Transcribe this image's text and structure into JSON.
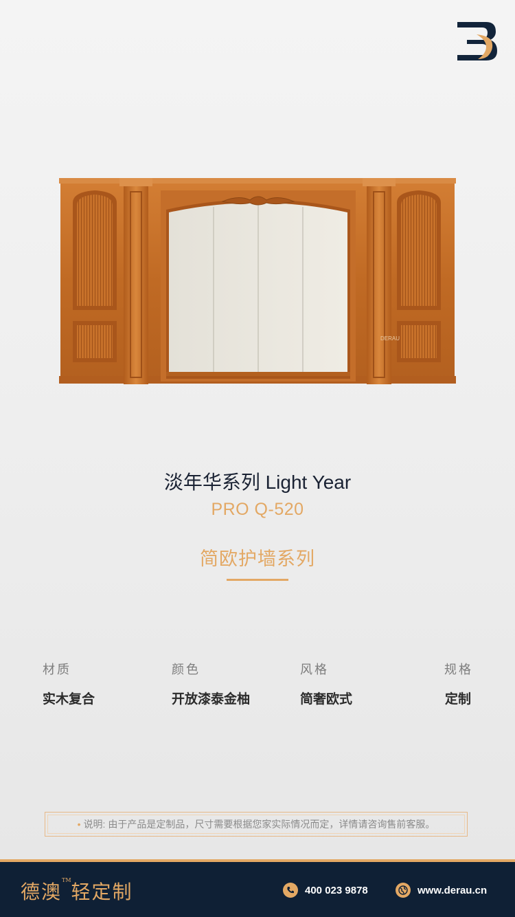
{
  "product": {
    "title": "淡年华系列  Light Year",
    "model": "PRO Q-520",
    "series": "简欧护墙系列",
    "watermark": "DERAU"
  },
  "specs": [
    {
      "label": "材质",
      "value": "实木复合"
    },
    {
      "label": "颜色",
      "value": "开放漆泰金柚"
    },
    {
      "label": "风格",
      "value": "简奢欧式"
    },
    {
      "label": "规格",
      "value": "定制"
    }
  ],
  "note": "说明: 由于产品是定制品，尺寸需要根据您家实际情况而定，详情请咨询售前客服。",
  "footer": {
    "brand": "德澳",
    "tm": "TM",
    "brand_sub": "轻定制",
    "phone": "400 023 9878",
    "website": "www.derau.cn"
  },
  "colors": {
    "accent": "#e3a864",
    "navy": "#0f2035",
    "wood": "#c8702a"
  },
  "icons": [
    "brand-logo-icon",
    "phone-icon",
    "globe-icon"
  ]
}
